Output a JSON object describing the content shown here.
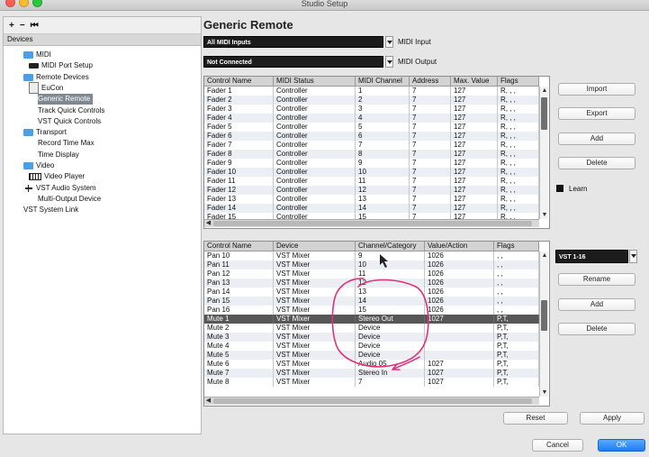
{
  "window": {
    "title": "Studio Setup",
    "controls": [
      "#fd5f57",
      "#fdbc2e",
      "#28c840"
    ]
  },
  "toolbar": {
    "add": "+",
    "remove": "−",
    "reset": "⏮"
  },
  "sidebar": {
    "header": "Devices",
    "items": [
      {
        "label": "MIDI",
        "icon": "folder-icon"
      },
      {
        "label": "MIDI Port Setup",
        "icon": "midi-port-icon"
      },
      {
        "label": "Remote Devices",
        "icon": "folder-icon"
      },
      {
        "label": "EuCon",
        "icon": "eucon-icon"
      },
      {
        "label": "Generic Remote",
        "icon": "",
        "selected": true
      },
      {
        "label": "Track Quick Controls",
        "icon": ""
      },
      {
        "label": "VST Quick Controls",
        "icon": ""
      },
      {
        "label": "Transport",
        "icon": "folder-icon"
      },
      {
        "label": "Record Time Max",
        "icon": ""
      },
      {
        "label": "Time Display",
        "icon": ""
      },
      {
        "label": "Video",
        "icon": "folder-icon"
      },
      {
        "label": "Video Player",
        "icon": "video-player-icon"
      },
      {
        "label": "VST Audio System",
        "icon": "vst-audio-icon"
      },
      {
        "label": "Multi-Output Device",
        "icon": ""
      },
      {
        "label": "VST System Link",
        "icon": ""
      }
    ]
  },
  "main": {
    "title": "Generic Remote",
    "midi_input": {
      "value": "All MIDI Inputs",
      "label": "MIDI Input"
    },
    "midi_output": {
      "value": "Not Connected",
      "label": "MIDI Output"
    },
    "top_table": {
      "columns": [
        "Control Name",
        "MIDI Status",
        "MIDI Channel",
        "Address",
        "Max. Value",
        "Flags"
      ],
      "rows": [
        [
          "Fader 1",
          "Controller",
          "1",
          "7",
          "127",
          "R, , ,"
        ],
        [
          "Fader 2",
          "Controller",
          "2",
          "7",
          "127",
          "R, , ,"
        ],
        [
          "Fader 3",
          "Controller",
          "3",
          "7",
          "127",
          "R, , ,"
        ],
        [
          "Fader 4",
          "Controller",
          "4",
          "7",
          "127",
          "R, , ,"
        ],
        [
          "Fader 5",
          "Controller",
          "5",
          "7",
          "127",
          "R, , ,"
        ],
        [
          "Fader 6",
          "Controller",
          "6",
          "7",
          "127",
          "R, , ,"
        ],
        [
          "Fader 7",
          "Controller",
          "7",
          "7",
          "127",
          "R, , ,"
        ],
        [
          "Fader 8",
          "Controller",
          "8",
          "7",
          "127",
          "R, , ,"
        ],
        [
          "Fader 9",
          "Controller",
          "9",
          "7",
          "127",
          "R, , ,"
        ],
        [
          "Fader 10",
          "Controller",
          "10",
          "7",
          "127",
          "R, , ,"
        ],
        [
          "Fader 11",
          "Controller",
          "11",
          "7",
          "127",
          "R, , ,"
        ],
        [
          "Fader 12",
          "Controller",
          "12",
          "7",
          "127",
          "R, , ,"
        ],
        [
          "Fader 13",
          "Controller",
          "13",
          "7",
          "127",
          "R, , ,"
        ],
        [
          "Fader 14",
          "Controller",
          "14",
          "7",
          "127",
          "R, , ,"
        ],
        [
          "Fader 15",
          "Controller",
          "15",
          "7",
          "127",
          "R, , ,"
        ]
      ]
    },
    "top_buttons": {
      "import": "Import",
      "export": "Export",
      "add": "Add",
      "delete": "Delete"
    },
    "learn_label": "Learn",
    "bottom_table": {
      "columns": [
        "Control Name",
        "Device",
        "Channel/Category",
        "Value/Action",
        "Flags"
      ],
      "rows": [
        [
          "Pan 10",
          "VST Mixer",
          "9",
          "1026",
          ", ,"
        ],
        [
          "Pan 11",
          "VST Mixer",
          "10",
          "1026",
          ", ,"
        ],
        [
          "Pan 12",
          "VST Mixer",
          "11",
          "1026",
          ", ,"
        ],
        [
          "Pan 13",
          "VST Mixer",
          "12",
          "1026",
          ", ,"
        ],
        [
          "Pan 14",
          "VST Mixer",
          "13",
          "1026",
          ", ,"
        ],
        [
          "Pan 15",
          "VST Mixer",
          "14",
          "1026",
          ", ,"
        ],
        [
          "Pan 16",
          "VST Mixer",
          "15",
          "1026",
          ", ,"
        ],
        [
          "Mute 1",
          "VST Mixer",
          "Stereo Out",
          "1027",
          "P,T,"
        ],
        [
          "Mute 2",
          "VST Mixer",
          "Device",
          "",
          "P,T,"
        ],
        [
          "Mute 3",
          "VST Mixer",
          "Device",
          "",
          "P,T,"
        ],
        [
          "Mute 4",
          "VST Mixer",
          "Device",
          "",
          "P,T,"
        ],
        [
          "Mute 5",
          "VST Mixer",
          "Device",
          "",
          "P,T,"
        ],
        [
          "Mute 6",
          "VST Mixer",
          "Audio 05",
          "1027",
          "P,T,"
        ],
        [
          "Mute 7",
          "VST Mixer",
          "Stereo In",
          "1027",
          "P,T,"
        ],
        [
          "Mute 8",
          "VST Mixer",
          "7",
          "1027",
          "P,T,"
        ]
      ],
      "selected_row": 7
    },
    "bank": {
      "value": "VST 1-16"
    },
    "bottom_buttons": {
      "rename": "Rename",
      "add": "Add",
      "delete": "Delete"
    },
    "reset": "Reset",
    "apply": "Apply"
  },
  "footer": {
    "cancel": "Cancel",
    "ok": "OK"
  },
  "annotation": {
    "color": "#e0307a"
  }
}
